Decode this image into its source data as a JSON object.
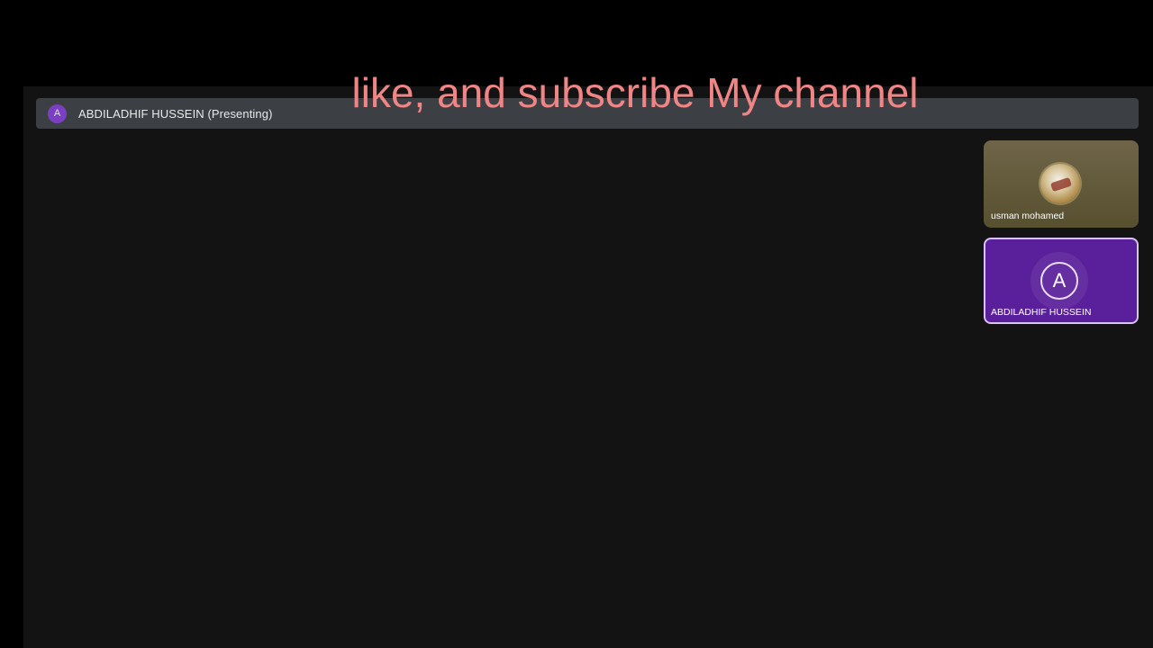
{
  "overlay": {
    "caption": "like, and subscribe My channel",
    "caption_color": "#f08585"
  },
  "presenter_bar": {
    "avatar_initial": "A",
    "label": "ABDILADHIF HUSSEIN (Presenting)"
  },
  "participants": [
    {
      "name": "usman mohamed",
      "avatar_type": "photo",
      "tile_color": "#6a5f42"
    },
    {
      "name": "ABDILADHIF HUSSEIN",
      "avatar_type": "initial",
      "initial": "A",
      "tile_color": "#5a1f9a",
      "active_speaker": true
    }
  ],
  "colors": {
    "background": "#000000",
    "stage": "#131313",
    "presenter_bar": "#3c3f43",
    "accent_purple": "#7b3fc4"
  }
}
